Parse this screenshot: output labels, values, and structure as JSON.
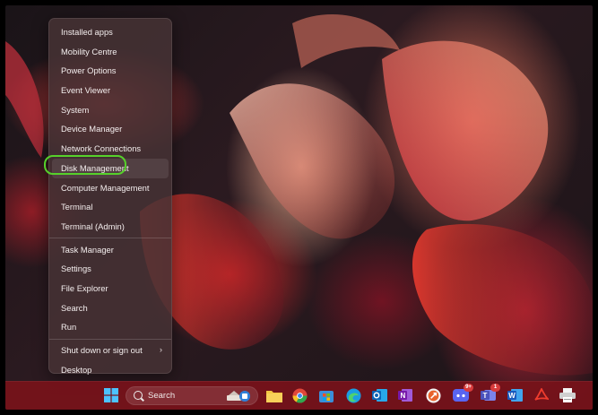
{
  "menu": {
    "items": [
      {
        "label": "Installed apps"
      },
      {
        "label": "Mobility Centre"
      },
      {
        "label": "Power Options"
      },
      {
        "label": "Event Viewer"
      },
      {
        "label": "System"
      },
      {
        "label": "Device Manager"
      },
      {
        "label": "Network Connections"
      },
      {
        "label": "Disk Management"
      },
      {
        "label": "Computer Management"
      },
      {
        "label": "Terminal"
      },
      {
        "label": "Terminal (Admin)"
      },
      {
        "label": "Task Manager"
      },
      {
        "label": "Settings"
      },
      {
        "label": "File Explorer"
      },
      {
        "label": "Search"
      },
      {
        "label": "Run"
      },
      {
        "label": "Shut down or sign out"
      },
      {
        "label": "Desktop"
      }
    ],
    "selected_item": "Disk Management",
    "submenu_chevron": "›"
  },
  "taskbar": {
    "search_label": "Search",
    "icons": [
      "windows-start-icon",
      "file-explorer-icon",
      "chrome-icon",
      "store-icon",
      "edge-icon",
      "outlook-icon",
      "onenote-icon",
      "remote-icon",
      "discord-icon",
      "teams-icon",
      "word-icon",
      "pdf-icon",
      "printer-icon"
    ],
    "badges": {
      "discord": "9+",
      "teams": "1"
    }
  },
  "colors": {
    "annotation_ring": "#56d12b",
    "taskbar": "#78121a"
  }
}
